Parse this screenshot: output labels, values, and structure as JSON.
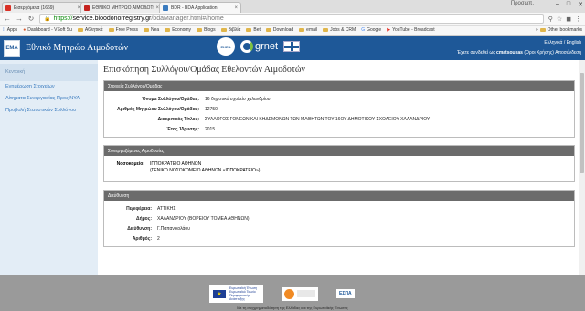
{
  "browser": {
    "tabs": [
      {
        "title": "Εισερχόμενα (1669)",
        "favicon_color": "#d93025",
        "active": false
      },
      {
        "title": "ΕΘΝΙΚΟ ΜΗΤΡΩΟ ΑΙΜΟΔΟΤΩΝ",
        "favicon_color": "#c5221f",
        "active": false
      },
      {
        "title": "BDR - BDA Application",
        "favicon_color": "#3a7bbf",
        "active": true
      }
    ],
    "user_label": "Προσωπ.",
    "url_scheme": "https://",
    "url_host": "service.bloodonorregistry.gr",
    "url_path": "/bdaManager.html#/home",
    "bookmarks": [
      "Apps",
      "Dashboard - VSoft Su",
      "Αθλητικά",
      "Free Press",
      "Nea",
      "Economy",
      "Blogs",
      "Βιβλία",
      "Bet",
      "Download",
      "email",
      "Jobs & CRM",
      "Google",
      "YouTube - Broadcast"
    ],
    "other_bookmarks": "Other bookmarks"
  },
  "header": {
    "logo_text": "ΕΜΑ",
    "title": "Εθνικό Μητρώο Αιμοδοτών",
    "ekea_label": "ΕΚΕΑ",
    "grnet_label": "grnet",
    "lang_link": "Ελληνικά / English",
    "user_line_prefix": "Έχετε συνδεθεί ως",
    "user_name": "cmatsoukas",
    "user_line_suffix": "(Όροι Χρήσης) Αποσύνδεση"
  },
  "sidebar": {
    "items": [
      {
        "label": "Κεντρική",
        "active": true
      },
      {
        "label": "Ενημέρωση Στοιχείων",
        "active": false
      },
      {
        "label": "Αίτηματα Συνεργασίας Προς ΝΥΑ",
        "active": false
      },
      {
        "label": "Προβολή Στατιστικών Συλλόγου",
        "active": false
      }
    ]
  },
  "main": {
    "title": "Επισκόπηση Συλλόγου/Ομάδας Εθελοντών Αιμοδοτών",
    "info_panel": {
      "heading": "Στοιχεία Συλλόγου/Ομάδας",
      "rows": [
        {
          "label": "Όνομα Συλλόγου/Ομάδας:",
          "value": "16 δημοτικό σχολείο χαλανδρίου"
        },
        {
          "label": "Αριθμός Μητρώου Συλλόγου/Ομάδας:",
          "value": "12750"
        },
        {
          "label": "Διακριτικός Τίτλος:",
          "value": "ΣΥΛΛΟΓΟΣ ΓΟΝΕΩΝ ΚΑΙ ΚΗΔΕΜΟΝΩΝ ΤΩΝ ΜΑΘΗΤΩΝ ΤΟΥ 16ΟΥ ΔΗΜΟΤΙΚΟΥ ΣΧΟΛΕΙΟΥ ΧΑΛΑΝΔΡΙΟΥ"
        },
        {
          "label": "Έτος Ίδρυσης:",
          "value": "2015"
        }
      ]
    },
    "coop_panel": {
      "heading": "Συνεργαζόμενες Αιμοδοσίες",
      "label": "Νοσοκομείο:",
      "line1": "ΙΠΠΟΚΡΑΤΕΙΟ ΑΘΗΝΩΝ",
      "line2": "(ΓΕΝΙΚΟ ΝΟΣΟΚΟΜΕΙΟ ΑΘΗΝΩΝ «ΙΠΠΟΚΡΑΤΕΙΟ»)"
    },
    "address_panel": {
      "heading": "Διεύθυνση",
      "rows": [
        {
          "label": "Περιφέρεια:",
          "value": "ΑΤΤΙΚΗΣ"
        },
        {
          "label": "Δήμος:",
          "value": "ΧΑΛΑΝΔΡΙΟΥ (ΒΟΡΕΙΟΥ ΤΟΜΕΑ ΑΘΗΝΩΝ)"
        },
        {
          "label": "Διεύθυνση:",
          "value": "Γ.Παπανικολάου"
        },
        {
          "label": "Αριθμός:",
          "value": "2"
        }
      ]
    }
  },
  "footer": {
    "eu_text": "Ευρωπαϊκή Ένωση Ευρωπαϊκό Ταμείο Περιφερειακής Ανάπτυξης",
    "espa_label": "ΕΣΠΑ",
    "note": "Με τη συγχρηματοδότηση της Ελλάδας και της Ευρωπαϊκής Ένωσης"
  },
  "colors": {
    "header_bg": "#1e5898",
    "sidebar_bg": "#e3edf6",
    "panel_head": "#6b6b6b",
    "footer_bg": "#9a9a9a"
  }
}
